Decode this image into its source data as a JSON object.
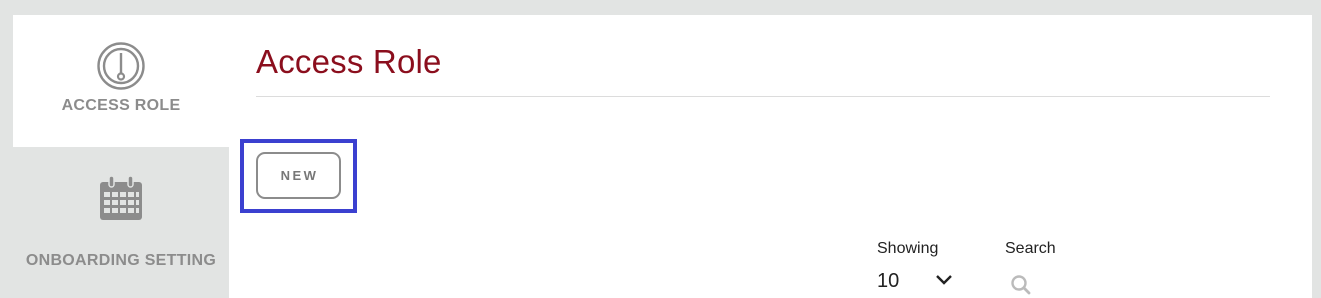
{
  "sidebar": {
    "items": [
      {
        "label": "ACCESS ROLE",
        "icon": "gauge-icon",
        "active": true
      },
      {
        "label": "ONBOARDING SETTING",
        "icon": "calendar-icon",
        "active": false
      }
    ]
  },
  "main": {
    "title": "Access Role",
    "new_button_label": "NEW",
    "table_controls": {
      "showing_label": "Showing",
      "page_size": "10",
      "search_label": "Search",
      "search_icon": "search-icon"
    }
  },
  "colors": {
    "title": "#8b0e1d",
    "highlight": "#3b40d0",
    "sidebar_inactive_bg": "#e2e4e3",
    "muted_text": "#8c8c8c"
  }
}
